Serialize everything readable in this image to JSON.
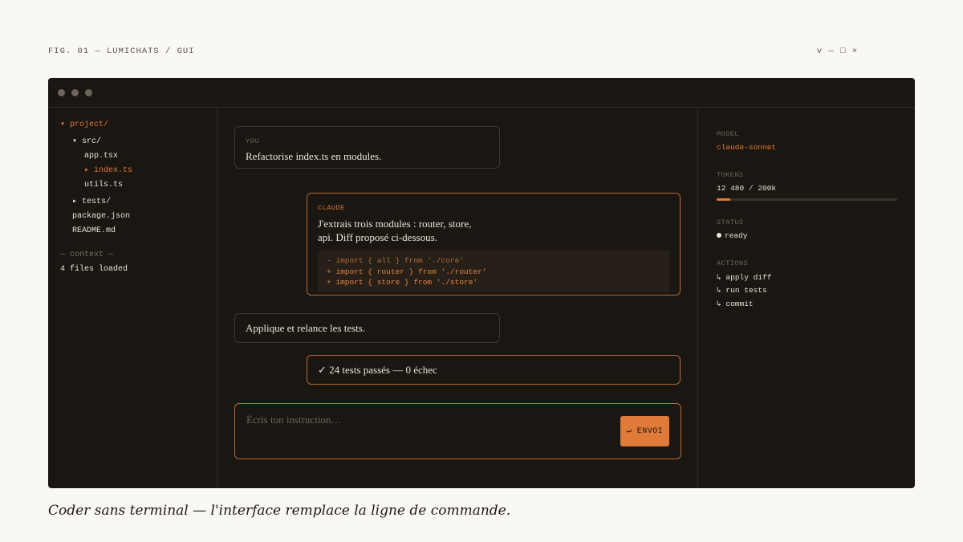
{
  "figure": {
    "label": "FIG. 01 — LUMICHATS / GUI",
    "window_controls": "v — □ ×",
    "caption": "Coder sans terminal — l'interface remplace la ligne de commande."
  },
  "sidebar": {
    "tree": [
      {
        "label": "▾ project/",
        "depth": 0,
        "accent": true
      },
      {
        "label": "▾ src/",
        "depth": 1,
        "accent": false
      },
      {
        "label": "app.tsx",
        "depth": 2,
        "accent": false
      },
      {
        "label": "▸ index.ts",
        "depth": 2,
        "accent": true
      },
      {
        "label": "utils.ts",
        "depth": 2,
        "accent": false
      },
      {
        "label": "▸ tests/",
        "depth": 1,
        "accent": false
      },
      {
        "label": "package.json",
        "depth": 1,
        "accent": false
      },
      {
        "label": "README.md",
        "depth": 1,
        "accent": false
      }
    ],
    "context_label": "— context —",
    "context_value": "4 files loaded"
  },
  "chat": {
    "messages": [
      {
        "role": "user",
        "author": "YOU",
        "text": "Refactorise index.ts en modules."
      },
      {
        "role": "assistant",
        "author": "CLAUDE",
        "text_line1": "J'extrais trois modules : router, store,",
        "text_line2": "api. Diff proposé ci-dessous.",
        "code": [
          {
            "type": "del",
            "text": "- import { all } from './core'"
          },
          {
            "type": "add",
            "text": "+ import { router } from './router'"
          },
          {
            "type": "add",
            "text": "+ import { store } from './store'"
          }
        ]
      },
      {
        "role": "user",
        "text": "Applique et relance les tests."
      },
      {
        "role": "assistant",
        "text": "✓ 24 tests passés — 0 échec"
      }
    ],
    "composer": {
      "placeholder": "Écris ton instruction…",
      "value": "",
      "send_label": "↵ ENVOI"
    }
  },
  "panel": {
    "model_label": "MODEL",
    "model_value": "claude-sonnet",
    "tokens_label": "TOKENS",
    "tokens_value": "12 480 / 200k",
    "tokens_fraction": 0.0624,
    "status_label": "STATUS",
    "status_value": "ready",
    "actions_label": "ACTIONS",
    "actions": [
      "↳ apply diff",
      "↳ run tests",
      "↳ commit"
    ]
  },
  "colors": {
    "accent": "#e07a38",
    "window_bg": "#1a1612",
    "page_bg": "#faf8f4"
  }
}
